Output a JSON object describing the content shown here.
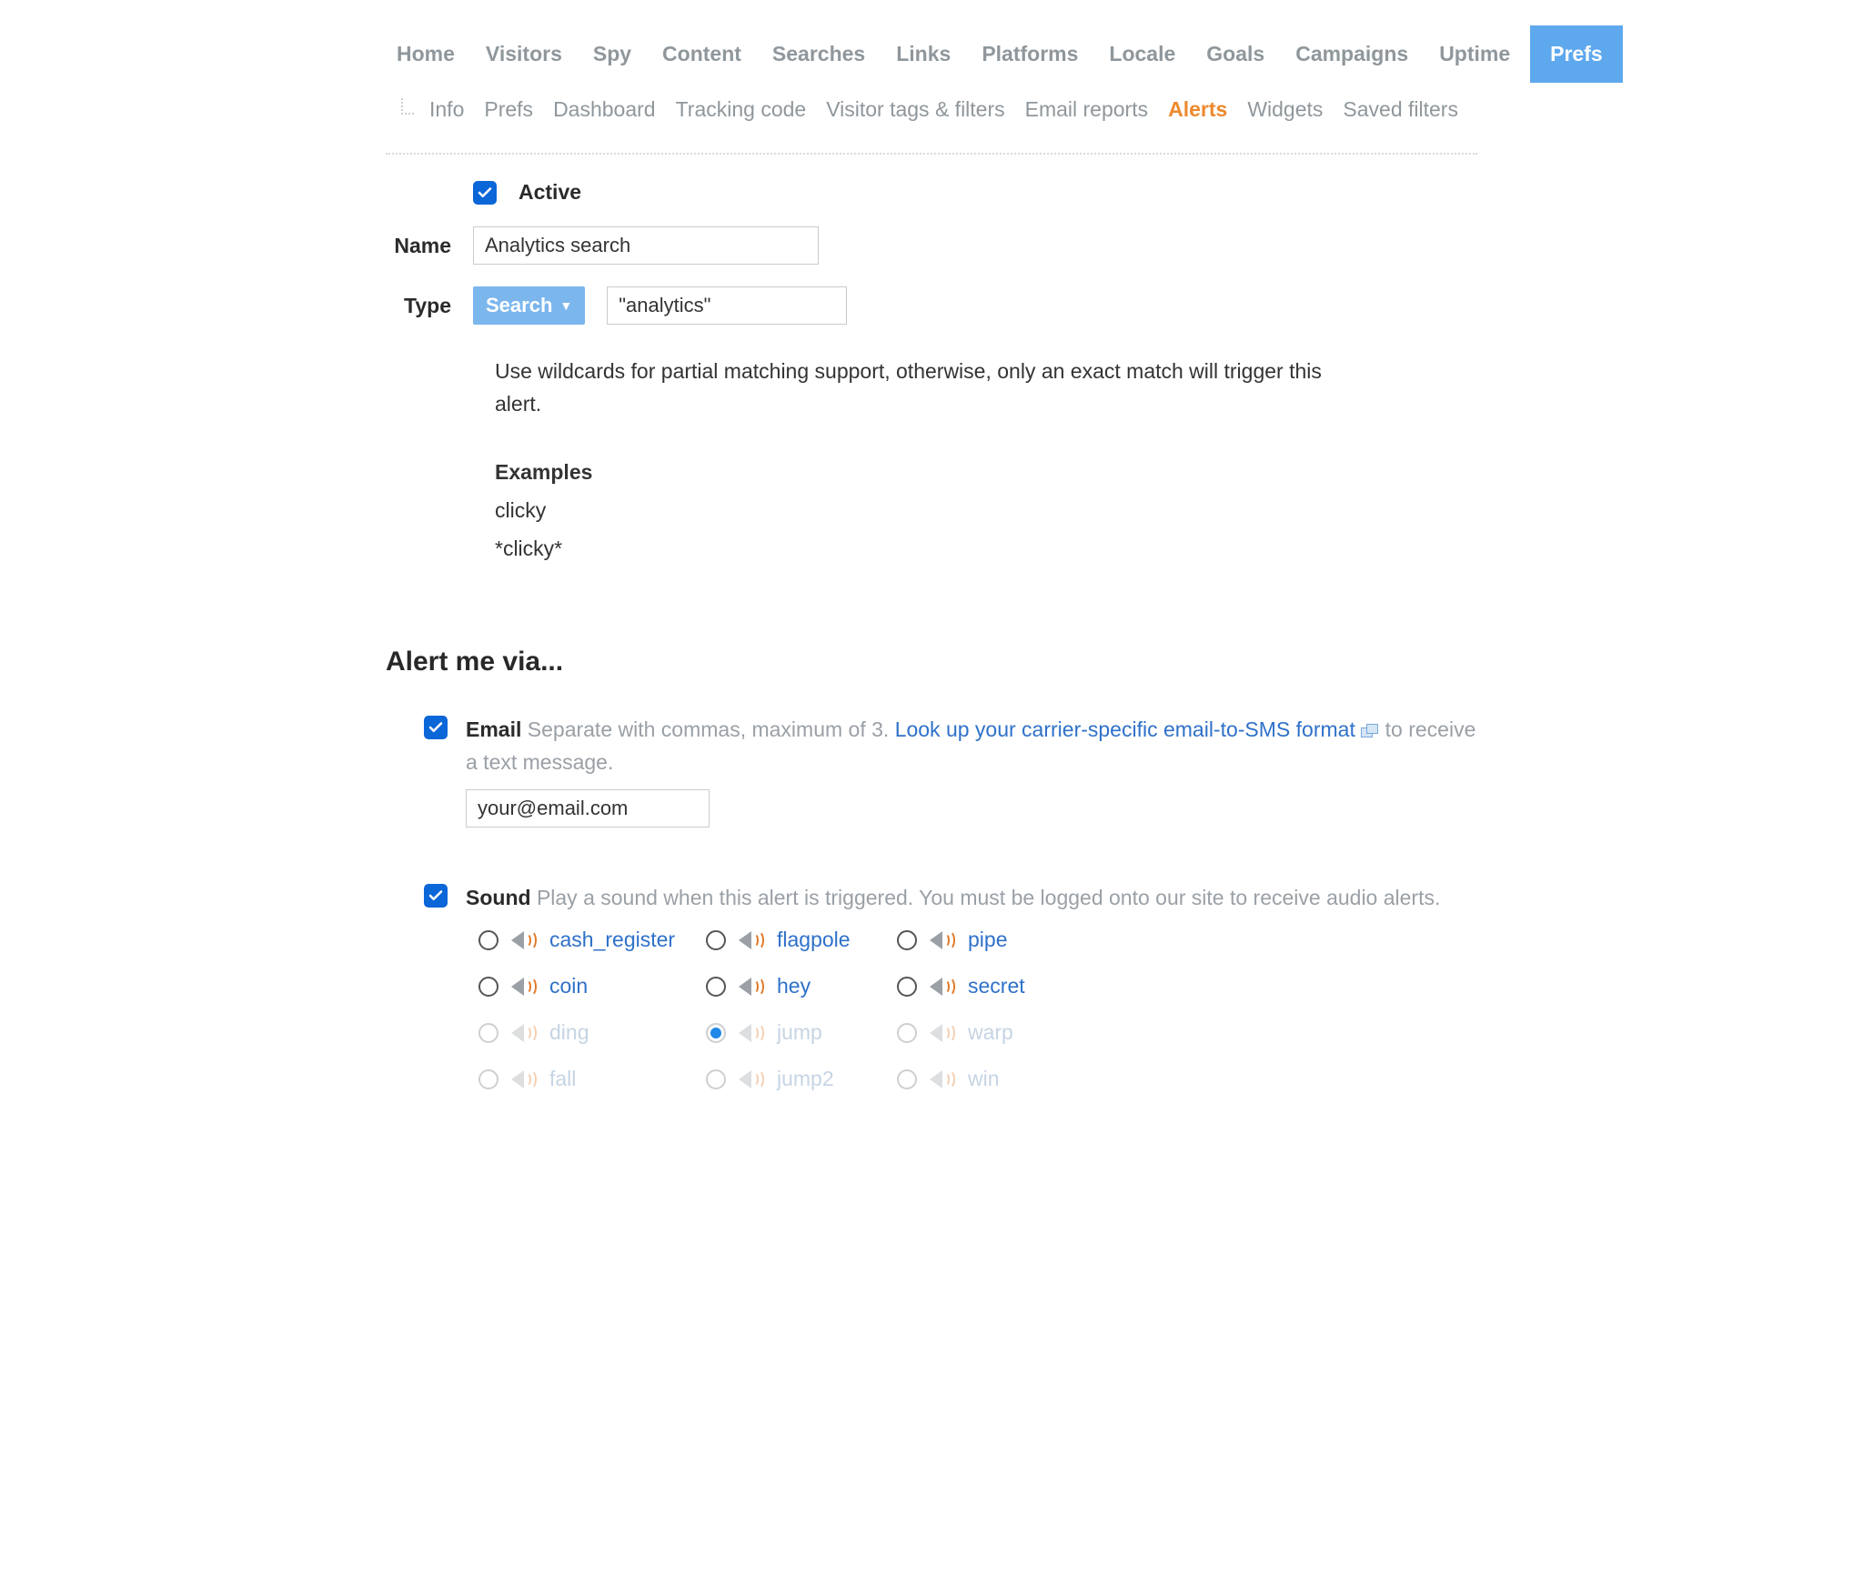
{
  "nav": {
    "top": [
      "Home",
      "Visitors",
      "Spy",
      "Content",
      "Searches",
      "Links",
      "Platforms",
      "Locale",
      "Goals",
      "Campaigns",
      "Uptime",
      "Prefs"
    ],
    "top_active": 11,
    "sub": [
      "Info",
      "Prefs",
      "Dashboard",
      "Tracking code",
      "Visitor tags & filters",
      "Email reports",
      "Alerts",
      "Widgets",
      "Saved filters"
    ],
    "sub_active": 6
  },
  "form": {
    "active": {
      "label": "Active",
      "checked": true
    },
    "name": {
      "label": "Name",
      "value": "Analytics search"
    },
    "type": {
      "label": "Type",
      "dropdown": "Search",
      "value": "\"analytics\""
    },
    "info": {
      "line": "Use wildcards for partial matching support, otherwise, only an exact match will trigger this alert.",
      "examples_title": "Examples",
      "example1": "clicky",
      "example2": "*clicky*"
    }
  },
  "alert": {
    "heading": "Alert me via...",
    "email": {
      "checked": true,
      "label": "Email",
      "hint_pre": "Separate with commas, maximum of 3. ",
      "link": "Look up your carrier-specific email-to-SMS format",
      "hint_post": " to receive a text message.",
      "value": "your@email.com"
    },
    "sound": {
      "checked": true,
      "label": "Sound",
      "hint": "Play a sound when this alert is triggered. You must be logged onto our site to receive audio alerts.",
      "selected": "jump",
      "options": [
        {
          "name": "cash_register",
          "disabled": false
        },
        {
          "name": "flagpole",
          "disabled": false
        },
        {
          "name": "pipe",
          "disabled": false
        },
        {
          "name": "coin",
          "disabled": false
        },
        {
          "name": "hey",
          "disabled": false
        },
        {
          "name": "secret",
          "disabled": false
        },
        {
          "name": "ding",
          "disabled": true
        },
        {
          "name": "jump",
          "disabled": true
        },
        {
          "name": "warp",
          "disabled": true
        },
        {
          "name": "fall",
          "disabled": true
        },
        {
          "name": "jump2",
          "disabled": true
        },
        {
          "name": "win",
          "disabled": true
        }
      ]
    }
  }
}
